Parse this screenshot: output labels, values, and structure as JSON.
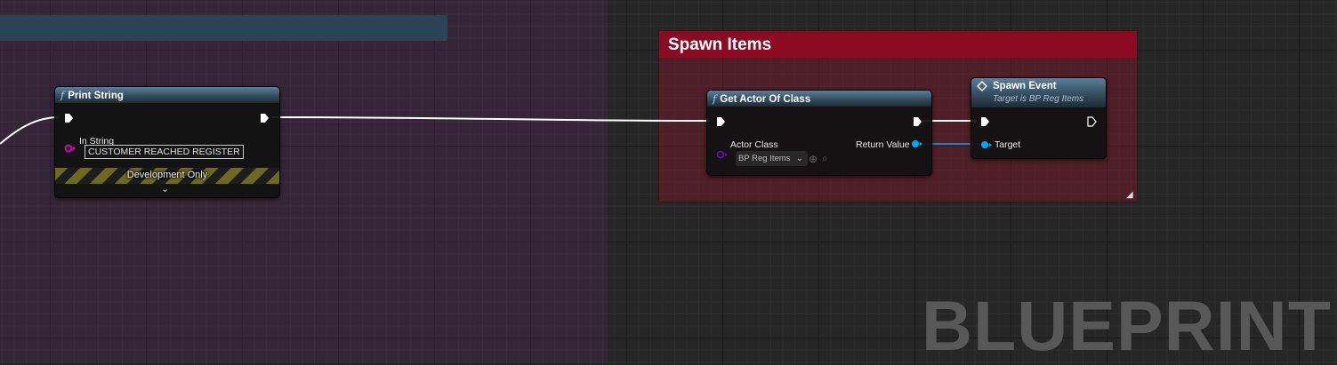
{
  "comment": {
    "title": "Spawn Items",
    "resize_icon": "diagonal-grip"
  },
  "nodes": {
    "print_string": {
      "title": "Print String",
      "icon": "function-f-icon",
      "in_string_label": "In String",
      "in_string_value": "CUSTOMER REACHED REGISTER",
      "dev_only_label": "Development Only",
      "expand_icon": "chevron-down-icon"
    },
    "get_actor": {
      "title": "Get Actor Of Class",
      "icon": "function-f-icon",
      "actor_class_label": "Actor Class",
      "actor_class_value": "BP Reg Items",
      "return_value_label": "Return Value"
    },
    "spawn_event": {
      "title": "Spawn Event",
      "subtitle": "Target is BP Reg Items",
      "icon": "event-diamond-icon",
      "target_label": "Target"
    }
  },
  "watermark": "BLUEPRINT",
  "colors": {
    "comment_header": "#8c0b22",
    "object_pin": "#00a8f4",
    "class_pin": "#5b10c2",
    "string_pin": "#e800c8",
    "exec_wire": "#ffffff"
  }
}
